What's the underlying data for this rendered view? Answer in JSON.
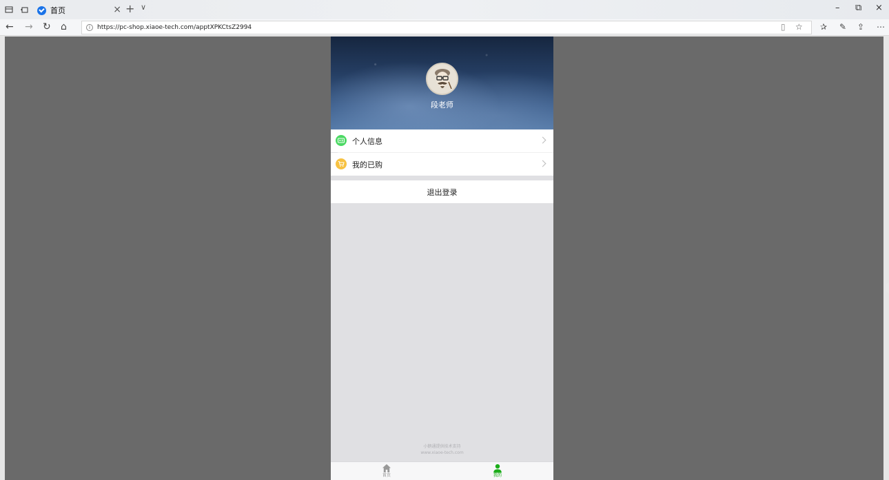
{
  "browser": {
    "tab_title": "首页",
    "url": "https://pc-shop.xiaoe-tech.com/apptXPKCtsZ2994",
    "colors": {
      "tab_favicon": "#1a73e8"
    }
  },
  "profile": {
    "name": "段老师"
  },
  "menu": {
    "items": [
      {
        "label": "个人信息",
        "icon": "id-card-icon",
        "color": "#4cd964"
      },
      {
        "label": "我的已购",
        "icon": "cart-icon",
        "color": "#f7c242"
      }
    ]
  },
  "logout_label": "退出登录",
  "footer": {
    "line1": "小鹅通提供技术支持",
    "line2": "www.xiaoe-tech.com"
  },
  "bottom_nav": {
    "items": [
      {
        "label": "首页",
        "icon": "home-icon",
        "active": false
      },
      {
        "label": "我的",
        "icon": "user-icon",
        "active": true
      }
    ],
    "colors": {
      "active": "#1aad19",
      "inactive": "#999999"
    }
  }
}
